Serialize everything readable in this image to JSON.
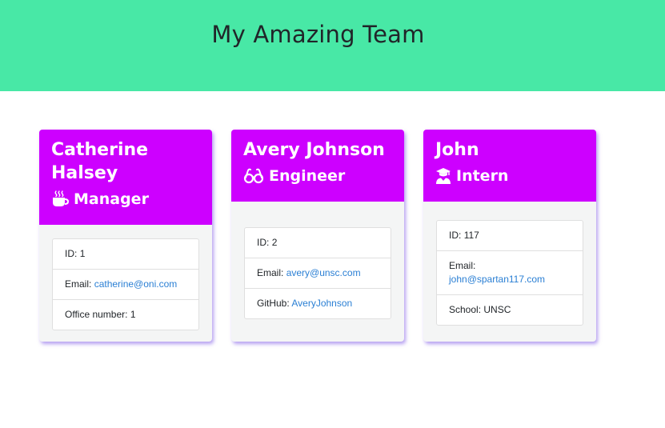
{
  "header": {
    "title": "My Amazing Team"
  },
  "team": [
    {
      "name": "Catherine Halsey",
      "role": "Manager",
      "role_icon": "coffee-icon",
      "id_label": "ID:",
      "id": "1",
      "email_label": "Email:",
      "email": "catherine@oni.com",
      "extra_label": "Office number:",
      "extra": "1"
    },
    {
      "name": "Avery Johnson",
      "role": "Engineer",
      "role_icon": "glasses-icon",
      "id_label": "ID:",
      "id": "2",
      "email_label": "Email:",
      "email": "avery@unsc.com",
      "extra_label": "GitHub:",
      "extra": "AveryJohnson"
    },
    {
      "name": "John",
      "role": "Intern",
      "role_icon": "graduate-icon",
      "id_label": "ID:",
      "id": "117",
      "email_label": "Email:",
      "email": "john@spartan117.com",
      "extra_label": "School:",
      "extra": "UNSC"
    }
  ],
  "colors": {
    "jumbotron": "#48e8a6",
    "card_header": "#cd00ff",
    "link": "#2a7fd4"
  }
}
